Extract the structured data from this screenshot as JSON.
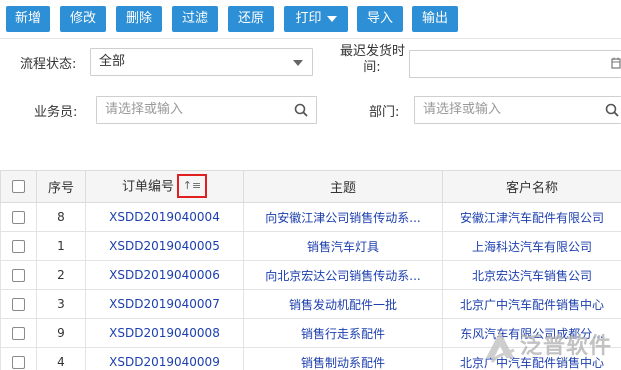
{
  "toolbar": {
    "buttons": [
      "新增",
      "修改",
      "删除",
      "过滤",
      "还原",
      "打印",
      "导入",
      "输出"
    ]
  },
  "filters": {
    "process_status": {
      "label": "流程状态:",
      "value": "全部"
    },
    "latest_ship_time": {
      "label_line1": "最迟发货时",
      "label_line2": "间:",
      "value": ""
    },
    "salesperson": {
      "label": "业务员:",
      "placeholder": "请选择或输入"
    },
    "department": {
      "label": "部门:",
      "placeholder": "请选择或输入"
    }
  },
  "table": {
    "headers": {
      "seq": "序号",
      "order_no": "订单编号",
      "subject": "主题",
      "customer": "客户名称"
    },
    "sort_icon": "sort-icon",
    "rows": [
      {
        "seq": "8",
        "order_no": "XSDD2019040004",
        "subject": "向安徽江津公司销售传动系...",
        "customer": "安徽江津汽车配件有限公司"
      },
      {
        "seq": "1",
        "order_no": "XSDD2019040005",
        "subject": "销售汽车灯具",
        "customer": "上海科达汽车有限公司"
      },
      {
        "seq": "2",
        "order_no": "XSDD2019040006",
        "subject": "向北京宏达公司销售传动系...",
        "customer": "北京宏达汽车销售公司"
      },
      {
        "seq": "3",
        "order_no": "XSDD2019040007",
        "subject": "销售发动机配件一批",
        "customer": "北京广中汽车配件销售中心"
      },
      {
        "seq": "9",
        "order_no": "XSDD2019040008",
        "subject": "销售行走系配件",
        "customer": "东风汽车有限公司成都分..."
      },
      {
        "seq": "4",
        "order_no": "XSDD2019040009",
        "subject": "销售制动系配件",
        "customer": "北京广中汽车配件销售中心"
      }
    ]
  },
  "watermark": {
    "text": "泛普软件"
  },
  "colors": {
    "button_bg": "#2d8fd5",
    "link": "#1c3fae",
    "sort_highlight": "#e02020"
  }
}
